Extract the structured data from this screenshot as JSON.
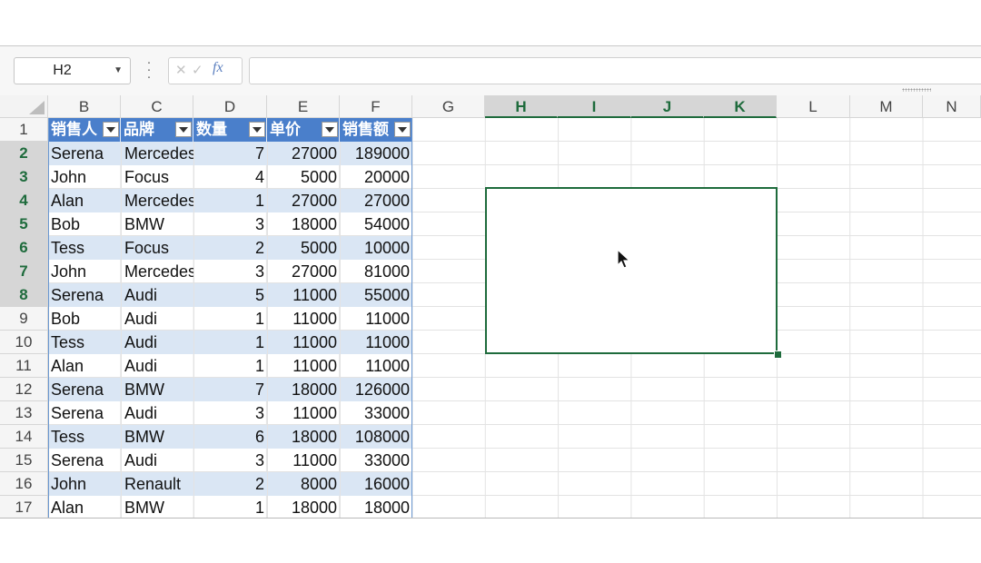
{
  "formula_bar": {
    "name_box": "H2",
    "fx_label": "fx",
    "formula": ""
  },
  "columns": [
    "B",
    "C",
    "D",
    "E",
    "F",
    "G",
    "H",
    "I",
    "J",
    "K",
    "L",
    "M",
    "N"
  ],
  "selected_columns": [
    "H",
    "I",
    "J",
    "K"
  ],
  "row_numbers": [
    "1",
    "2",
    "3",
    "4",
    "5",
    "6",
    "7",
    "8",
    "9",
    "10",
    "11",
    "12",
    "13",
    "14",
    "15",
    "16",
    "17"
  ],
  "selected_rows": [
    "2",
    "3",
    "4",
    "5",
    "6",
    "7",
    "8"
  ],
  "table": {
    "headers": [
      "销售人",
      "品牌",
      "数量",
      "单价",
      "销售额"
    ],
    "rows": [
      [
        "Serena",
        "Mercedes",
        "7",
        "27000",
        "189000"
      ],
      [
        "John",
        "Focus",
        "4",
        "5000",
        "20000"
      ],
      [
        "Alan",
        "Mercedes",
        "1",
        "27000",
        "27000"
      ],
      [
        "Bob",
        "BMW",
        "3",
        "18000",
        "54000"
      ],
      [
        "Tess",
        "Focus",
        "2",
        "5000",
        "10000"
      ],
      [
        "John",
        "Mercedes",
        "3",
        "27000",
        "81000"
      ],
      [
        "Serena",
        "Audi",
        "5",
        "11000",
        "55000"
      ],
      [
        "Bob",
        "Audi",
        "1",
        "11000",
        "11000"
      ],
      [
        "Tess",
        "Audi",
        "1",
        "11000",
        "11000"
      ],
      [
        "Alan",
        "Audi",
        "1",
        "11000",
        "11000"
      ],
      [
        "Serena",
        "BMW",
        "7",
        "18000",
        "126000"
      ],
      [
        "Serena",
        "Audi",
        "3",
        "11000",
        "33000"
      ],
      [
        "Tess",
        "BMW",
        "6",
        "18000",
        "108000"
      ],
      [
        "Serena",
        "Audi",
        "3",
        "11000",
        "33000"
      ],
      [
        "John",
        "Renault",
        "2",
        "8000",
        "16000"
      ],
      [
        "Alan",
        "BMW",
        "1",
        "18000",
        "18000"
      ]
    ]
  },
  "colors": {
    "accent_green": "#1e6b3c",
    "table_header": "#4a7fcb",
    "table_band": "#dae6f4"
  }
}
